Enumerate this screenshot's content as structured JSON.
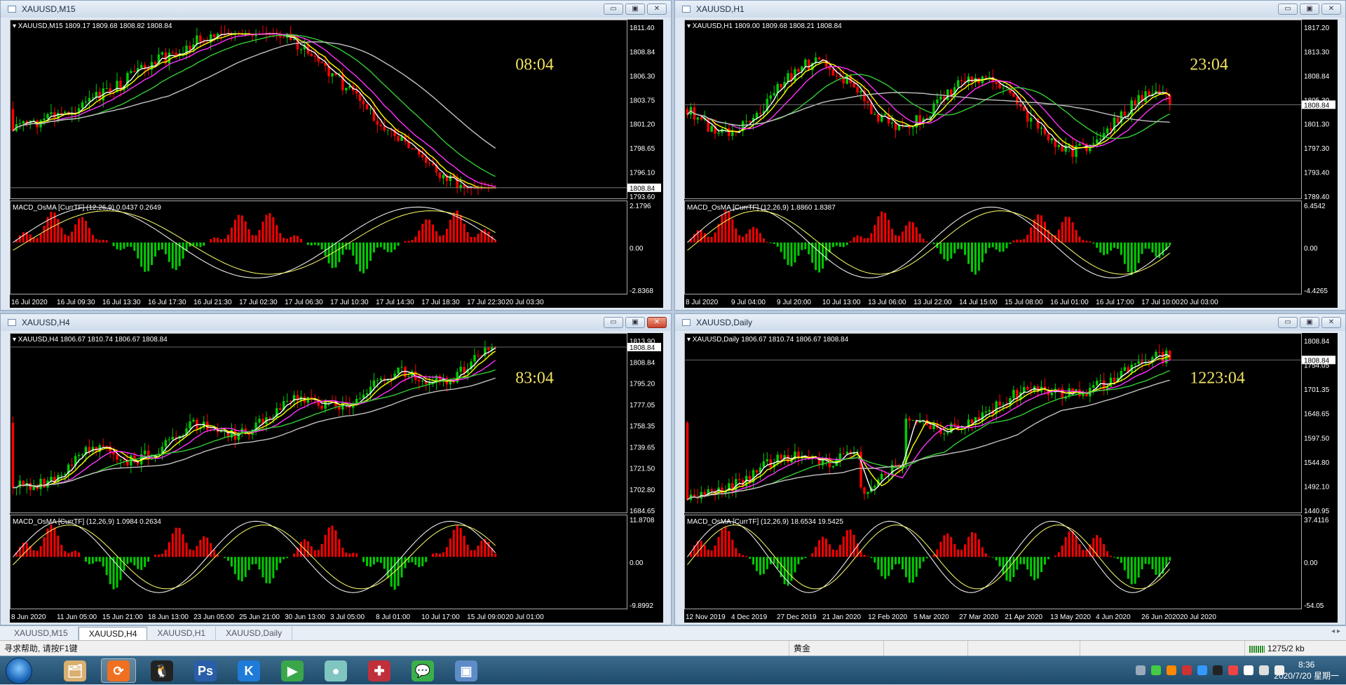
{
  "windows": [
    {
      "id": "m15",
      "title": "XAUUSD,M15",
      "info": "XAUUSD,M15  1809.17 1809.68 1808.82 1808.84",
      "countdown": "08:04",
      "current_price": "1808.84",
      "price_labels": [
        "1811.40",
        "1808.84",
        "1806.30",
        "1803.75",
        "1801.20",
        "1798.65",
        "1796.10",
        "1793.60"
      ],
      "osc_info": "MACD_OsMA [CurrTF] (12,26,9) 0.0437 0.2649",
      "osc_labels": [
        "2.1796",
        "0.00",
        "-2.8368"
      ],
      "time_labels": [
        "16 Jul 2020",
        "16 Jul 09:30",
        "16 Jul 13:30",
        "16 Jul 17:30",
        "16 Jul 21:30",
        "17 Jul 02:30",
        "17 Jul 06:30",
        "17 Jul 10:30",
        "17 Jul 14:30",
        "17 Jul 18:30",
        "17 Jul 22:30",
        "20 Jul 03:30"
      ],
      "close_red": false
    },
    {
      "id": "h1",
      "title": "XAUUSD,H1",
      "info": "XAUUSD,H1  1809.00 1809.68 1808.21 1808.84",
      "countdown": "23:04",
      "current_price": "1808.84",
      "price_labels": [
        "1817.20",
        "1813.30",
        "1808.84",
        "1805.30",
        "1801.30",
        "1797.30",
        "1793.40",
        "1789.40"
      ],
      "osc_info": "MACD_OsMA [CurrTF] (12,26,9) 1.8860 1.8387",
      "osc_labels": [
        "6.4542",
        "0.00",
        "-4.4265"
      ],
      "time_labels": [
        "8 Jul 2020",
        "9 Jul 04:00",
        "9 Jul 20:00",
        "10 Jul 13:00",
        "13 Jul 06:00",
        "13 Jul 22:00",
        "14 Jul 15:00",
        "15 Jul 08:00",
        "16 Jul 01:00",
        "16 Jul 17:00",
        "17 Jul 10:00",
        "20 Jul 03:00"
      ],
      "close_red": false
    },
    {
      "id": "h4",
      "title": "XAUUSD,H4",
      "info": "XAUUSD,H4  1806.67 1810.74 1806.67 1808.84",
      "countdown": "83:04",
      "current_price": "1808.84",
      "price_labels": [
        "1813.90",
        "1808.84",
        "1795.20",
        "1777.05",
        "1758.35",
        "1739.65",
        "1721.50",
        "1702.80",
        "1684.65"
      ],
      "osc_info": "MACD_OsMA [CurrTF] (12,26,9) 1.0984 0.2634",
      "osc_labels": [
        "11.8708",
        "0.00",
        "-9.8992"
      ],
      "time_labels": [
        "8 Jun 2020",
        "11 Jun 05:00",
        "15 Jun 21:00",
        "18 Jun 13:00",
        "23 Jun 05:00",
        "25 Jun 21:00",
        "30 Jun 13:00",
        "3 Jul 05:00",
        "8 Jul 01:00",
        "10 Jul 17:00",
        "15 Jul 09:00",
        "20 Jul 01:00"
      ],
      "close_red": true
    },
    {
      "id": "d1",
      "title": "XAUUSD,Daily",
      "info": "XAUUSD,Daily  1806.67 1810.74 1806.67 1808.84",
      "countdown": "1223:04",
      "current_price": "1808.84",
      "price_labels": [
        "1808.84",
        "1754.05",
        "1701.35",
        "1648.65",
        "1597.50",
        "1544.80",
        "1492.10",
        "1440.95"
      ],
      "osc_info": "MACD_OsMA [CurrTF] (12,26,9) 18.6534 19.5425",
      "osc_labels": [
        "37.4116",
        "0.00",
        "-54.05"
      ],
      "time_labels": [
        "12 Nov 2019",
        "4 Dec 2019",
        "27 Dec 2019",
        "21 Jan 2020",
        "12 Feb 2020",
        "5 Mar 2020",
        "27 Mar 2020",
        "21 Apr 2020",
        "13 May 2020",
        "4 Jun 2020",
        "26 Jun 2020",
        "20 Jul 2020"
      ],
      "close_red": false
    }
  ],
  "window_buttons": {
    "minimize": "▭",
    "restore": "▣",
    "close": "✕"
  },
  "tabs": [
    "XAUUSD,M15",
    "XAUUSD,H4",
    "XAUUSD,H1",
    "XAUUSD,Daily"
  ],
  "active_tab": 1,
  "tab_scroll": "◂ ▸",
  "status": {
    "help": "寻求帮助, 请按F1键",
    "profile": "黄金",
    "traffic": "1275/2 kb"
  },
  "taskbar": {
    "apps": [
      {
        "name": "explorer",
        "glyph": "🗂",
        "active": false
      },
      {
        "name": "metatrader",
        "glyph": "⟳",
        "active": true
      },
      {
        "name": "qq",
        "glyph": "🐧",
        "active": false
      },
      {
        "name": "photoshop",
        "glyph": "Ps",
        "active": false
      },
      {
        "name": "kugou",
        "glyph": "K",
        "active": false
      },
      {
        "name": "player",
        "glyph": "▶",
        "active": false
      },
      {
        "name": "chat-bubble",
        "glyph": "●",
        "active": false
      },
      {
        "name": "uk-flag",
        "glyph": "✚",
        "active": false
      },
      {
        "name": "wechat",
        "glyph": "💬",
        "active": false
      },
      {
        "name": "screen",
        "glyph": "▣",
        "active": false
      }
    ],
    "clock_time": "8:36",
    "clock_date": "2020/7/20 星期一"
  },
  "colors": {
    "bg": "#000000",
    "bull": "#00cc00",
    "bear": "#ff0000",
    "ma_fast": "#ffffff",
    "ma_yellow": "#ffff00",
    "ma_magenta": "#ff33ff",
    "ma_green": "#33cc33",
    "ma_silver": "#c0c0c0",
    "countdown": "#f0e060"
  }
}
